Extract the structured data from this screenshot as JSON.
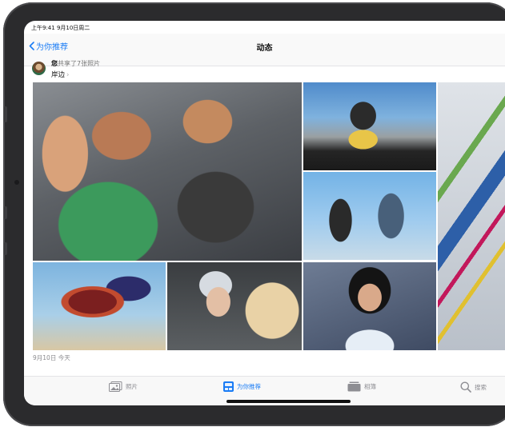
{
  "status_bar": {
    "time_date": "上午9:41  9月10日周二"
  },
  "nav": {
    "back_label": "为你推荐",
    "title": "动态"
  },
  "post": {
    "sharer_name": "您",
    "shared_text": "共享了7张照片",
    "location": "岸边"
  },
  "date_label": "9月10日 今天",
  "tabs": [
    {
      "label": "照片",
      "icon": "photos-icon",
      "active": false
    },
    {
      "label": "为你推荐",
      "icon": "for-you-icon",
      "active": true
    },
    {
      "label": "相簿",
      "icon": "albums-icon",
      "active": false
    },
    {
      "label": "搜索",
      "icon": "search-icon",
      "active": false
    }
  ],
  "colors": {
    "accent": "#1a7cf5",
    "device_bezel": "#2b2b2d"
  }
}
